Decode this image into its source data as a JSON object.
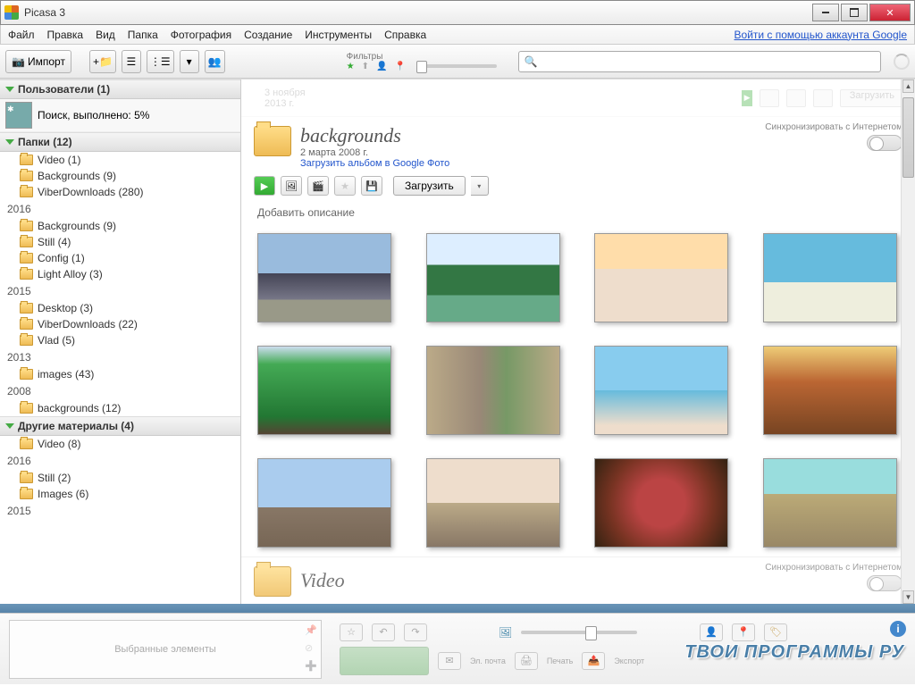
{
  "window": {
    "title": "Picasa 3"
  },
  "menu": {
    "items": [
      "Файл",
      "Правка",
      "Вид",
      "Папка",
      "Фотография",
      "Создание",
      "Инструменты",
      "Справка"
    ],
    "login": "Войти с помощью аккаунта Google"
  },
  "toolbar": {
    "import": "Импорт",
    "filters_label": "Фильтры"
  },
  "sidebar": {
    "users_header": "Пользователи (1)",
    "search_status": "Поиск, выполнено: 5%",
    "folders_header": "Папки (12)",
    "top_folders": [
      {
        "name": "Video",
        "count": "(1)"
      },
      {
        "name": "Backgrounds",
        "count": "(9)"
      },
      {
        "name": "ViberDownloads",
        "count": "(280)"
      }
    ],
    "years": [
      {
        "year": "2016",
        "folders": [
          {
            "name": "Backgrounds",
            "count": "(9)"
          },
          {
            "name": "Still",
            "count": "(4)"
          },
          {
            "name": "Config",
            "count": "(1)"
          },
          {
            "name": "Light Alloy",
            "count": "(3)"
          }
        ]
      },
      {
        "year": "2015",
        "folders": [
          {
            "name": "Desktop",
            "count": "(3)"
          },
          {
            "name": "ViberDownloads",
            "count": "(22)"
          },
          {
            "name": "Vlad",
            "count": "(5)"
          }
        ]
      },
      {
        "year": "2013",
        "folders": [
          {
            "name": "images",
            "count": "(43)"
          }
        ]
      },
      {
        "year": "2008",
        "folders": [
          {
            "name": "backgrounds",
            "count": "(12)"
          }
        ]
      }
    ],
    "other_header": "Другие материалы (4)",
    "other_top": [
      {
        "name": "Video",
        "count": "(8)"
      }
    ],
    "other_years": [
      {
        "year": "2016",
        "folders": [
          {
            "name": "Still",
            "count": "(2)"
          },
          {
            "name": "Images",
            "count": "(6)"
          }
        ]
      },
      {
        "year": "2015",
        "folders": []
      }
    ]
  },
  "album": {
    "title": "backgrounds",
    "date": "2 марта 2008 г.",
    "upload_link": "Загрузить альбом в Google Фото",
    "sync_label": "Синхронизировать с Интернетом",
    "upload_btn": "Загрузить",
    "description_placeholder": "Добавить описание",
    "ghost_date": "3 ноября 2013 г.",
    "ghost_upload": "Загрузить"
  },
  "next_album": {
    "title": "Video"
  },
  "bottom": {
    "selected_label": "Выбранные элементы",
    "labels": [
      "Эл. почта",
      "Печать",
      "Экспорт"
    ],
    "watermark": "ТВОИ ПРОГРАММЫ РУ"
  }
}
